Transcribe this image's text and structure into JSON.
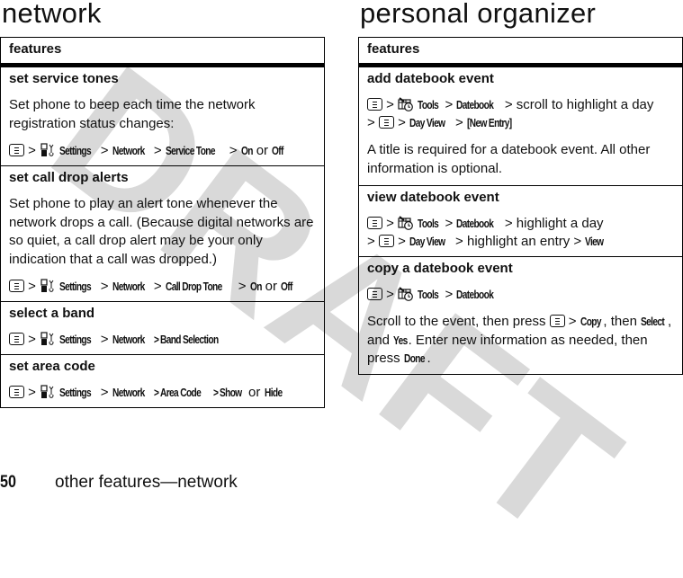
{
  "watermark": "DRAFT",
  "left": {
    "title": "network",
    "table_header": "features",
    "rows": [
      {
        "title": "set service tones",
        "body": "Set phone to beep each time the network registration status changes:",
        "path": {
          "icon": "settings-icon",
          "items": [
            "Settings",
            "Network",
            "Service Tone"
          ],
          "choice_a": "On",
          "or": "or",
          "choice_b": "Off"
        }
      },
      {
        "title": "set call drop alerts",
        "body": "Set phone to play an alert tone whenever the network drops a call. (Because digital networks are so quiet, a call drop alert may be your only indication that a call was dropped.)",
        "path": {
          "icon": "settings-icon",
          "items": [
            "Settings",
            "Network",
            "Call Drop Tone"
          ],
          "choice_a": "On",
          "or": "or",
          "choice_b": "Off"
        }
      },
      {
        "title": "select a band",
        "path": {
          "icon": "settings-icon",
          "items": [
            "Settings",
            "Network",
            "Band Selection"
          ]
        }
      },
      {
        "title": "set area code",
        "path": {
          "icon": "settings-icon",
          "items": [
            "Settings",
            "Network",
            "Area Code"
          ],
          "choice_a": "Show",
          "or": "or",
          "choice_b": "Hide"
        }
      }
    ]
  },
  "right": {
    "title": "personal organizer",
    "table_header": "features",
    "rows": [
      {
        "title": "add datebook event",
        "path": {
          "icon": "tools-icon",
          "tools": "Tools",
          "datebook": "Datebook",
          "step": "scroll to highlight a day",
          "dayview": "Day View",
          "final": "[New Entry]"
        },
        "body": "A title is required for a datebook event. All other information is optional."
      },
      {
        "title": "view datebook event",
        "path": {
          "icon": "tools-icon",
          "tools": "Tools",
          "datebook": "Datebook",
          "step": "highlight a day",
          "dayview": "Day View",
          "step2": "highlight an entry",
          "final": "View"
        }
      },
      {
        "title": "copy a datebook event",
        "path": {
          "icon": "tools-icon",
          "tools": "Tools",
          "datebook": "Datebook"
        },
        "body": {
          "t1": "Scroll to the event, then press",
          "copy": "Copy",
          "t2": ", then",
          "select": "Select",
          "t3": ",",
          "t4": "and",
          "yes": "Yes",
          "t5": ". Enter new information as needed, then press",
          "done": "Done",
          "t6": "."
        }
      }
    ]
  },
  "footer": {
    "page_number": "50",
    "label": "other features—network"
  },
  "symbols": {
    "gt": ">"
  }
}
